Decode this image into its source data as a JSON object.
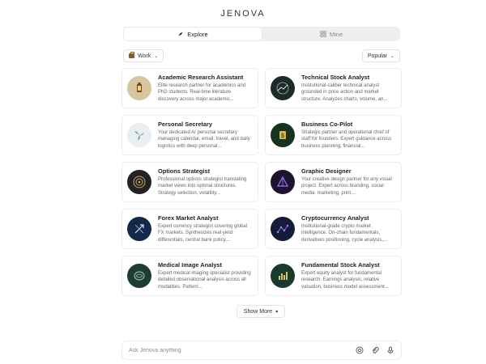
{
  "brand": "JENOVA",
  "tabs": [
    {
      "label": "Explore",
      "icon": "compass-icon",
      "active": true
    },
    {
      "label": "Mine",
      "icon": "grid-icon",
      "active": false
    }
  ],
  "filters": {
    "category": "Work",
    "category_icon": "briefcase-icon",
    "sort": "Popular"
  },
  "agents": [
    {
      "title": "Academic Research Assistant",
      "desc": "Elite research partner for academics and PhD students. Real-time literature discovery across major academic...",
      "icon": "lantern-icon",
      "bg": "#d7c59e"
    },
    {
      "title": "Technical Stock Analyst",
      "desc": "Institutional-caliber technical analyst grounded in price action and market structure. Analyzes charts, volume, an...",
      "icon": "chart-globe-icon",
      "bg": "#1e2a2a"
    },
    {
      "title": "Personal Secretary",
      "desc": "Your dedicated AI personal secretary managing calendar, email, travel, and daily logistics with deep personal...",
      "icon": "leaves-icon",
      "bg": "#e9eef0"
    },
    {
      "title": "Business Co-Pilot",
      "desc": "Strategic partner and operational chief of staff for founders. Expert guidance across business planning, financial...",
      "icon": "dollar-icon",
      "bg": "#15331e"
    },
    {
      "title": "Options Strategist",
      "desc": "Professional options strategist translating market views into optimal structures. Strategy selection, volatility...",
      "icon": "target-icon",
      "bg": "#222222"
    },
    {
      "title": "Graphic Designer",
      "desc": "Your creative design partner for any visual project. Expert across branding, social media, marketing, print,...",
      "icon": "prism-icon",
      "bg": "#1c1530"
    },
    {
      "title": "Forex Market Analyst",
      "desc": "Expert currency strategist covering global FX markets. Synthesizes real yield differentials, central bank policy,...",
      "icon": "exchange-arrows-icon",
      "bg": "#12294a"
    },
    {
      "title": "Cryptocurrency Analyst",
      "desc": "Institutional-grade crypto market intelligence. On-chain fundamentals, derivatives positioning, cycle analysis,...",
      "icon": "network-icon",
      "bg": "#141c3a"
    },
    {
      "title": "Medical Image Analyst",
      "desc": "Expert medical imaging specialist providing detailed observational analysis across all modalities. Pattern...",
      "icon": "brain-scan-icon",
      "bg": "#1e3d33"
    },
    {
      "title": "Fundamental Stock Analyst",
      "desc": "Expert equity analyst for fundamental research. Earnings analysis, relative valuation, business model assessment...",
      "icon": "bar-chart-icon",
      "bg": "#1a3b2c"
    }
  ],
  "show_more": "Show More",
  "chat": {
    "placeholder": "Ask Jenova anything",
    "icons": [
      "mention-icon",
      "attach-icon",
      "voice-icon"
    ]
  }
}
